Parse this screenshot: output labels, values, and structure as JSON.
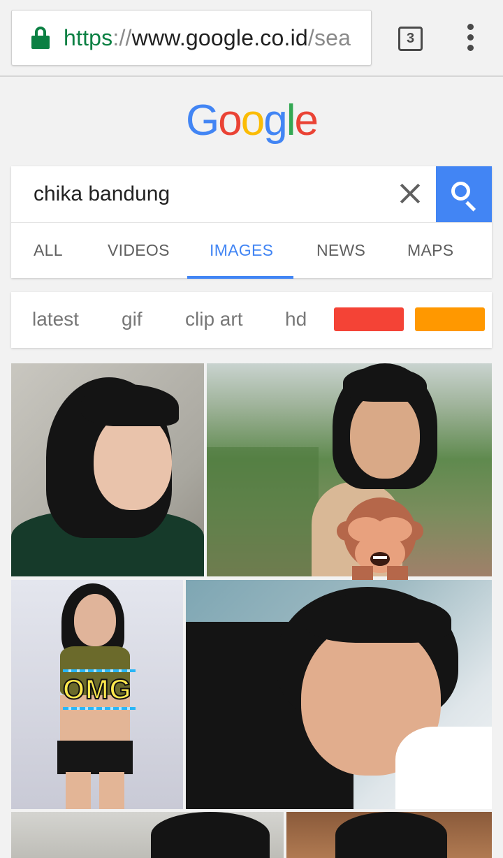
{
  "browser": {
    "url_scheme": "https",
    "url_sep": "://",
    "url_host": "www.google.co.id",
    "url_path": "/sea",
    "tab_count": "3"
  },
  "logo": {
    "letters": [
      "G",
      "o",
      "o",
      "g",
      "l",
      "e"
    ],
    "colors": [
      "#4285f4",
      "#ea4335",
      "#fbbc05",
      "#4285f4",
      "#34a853",
      "#ea4335"
    ]
  },
  "search": {
    "query": "chika bandung"
  },
  "tabs": [
    {
      "label": "ALL"
    },
    {
      "label": "VIDEOS"
    },
    {
      "label": "IMAGES"
    },
    {
      "label": "NEWS"
    },
    {
      "label": "MAPS"
    }
  ],
  "chips": {
    "labels": [
      "latest",
      "gif",
      "clip art",
      "hd"
    ],
    "colors": [
      "#f44336",
      "#ff9800"
    ]
  },
  "stickers": {
    "omg_text": "OMG"
  },
  "colors": {
    "accent": "#4285f4",
    "secure_green": "#0b8043"
  }
}
